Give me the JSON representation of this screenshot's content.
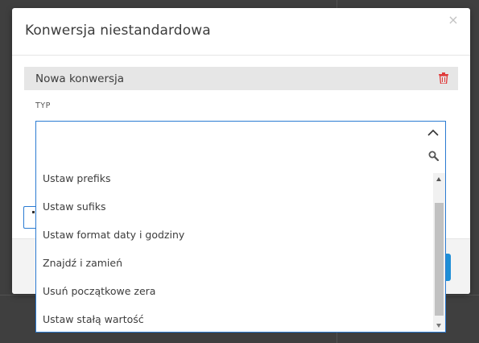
{
  "modal": {
    "title": "Konwersja niestandardowa",
    "close_glyph": "×"
  },
  "conversion": {
    "label": "Nowa konwersja",
    "delete_icon": "trash-icon",
    "delete_color": "#e03b3b"
  },
  "type_field": {
    "label": "TYP",
    "value": "",
    "toggle_icon": "chevron-up-icon"
  },
  "dropdown": {
    "search_icon": "search-icon",
    "options": [
      "Ustaw prefiks",
      "Ustaw sufiks",
      "Ustaw format daty i godziny",
      "Znajdź i zamień",
      "Usuń początkowe zera",
      "Ustaw stałą wartość"
    ],
    "scroll_position": 0.75
  },
  "colors": {
    "accent": "#2b7bd2",
    "primary_button": "#1e8ed6"
  }
}
